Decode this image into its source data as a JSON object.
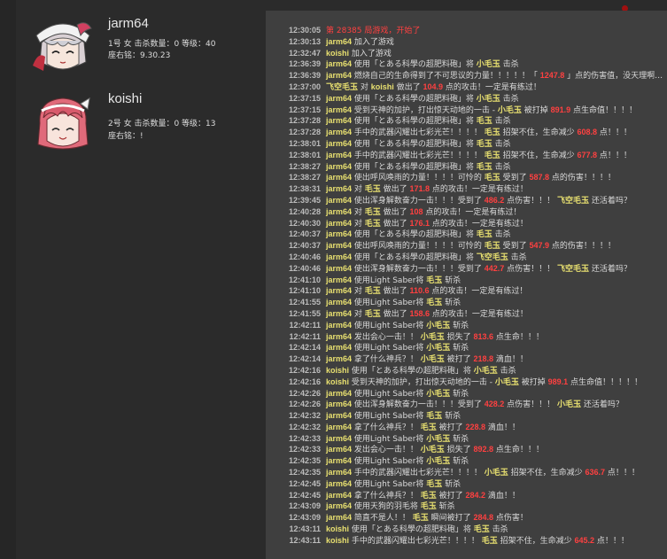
{
  "colors": {
    "background": "#2b2b2b",
    "log_background": "#3f3f3f",
    "timestamp": "#bdbdbd",
    "text": "#dadada",
    "name": "#e8e070",
    "number": "#ff4040"
  },
  "players": [
    {
      "name": "jarm64",
      "stats": "1号 女 击杀数量：0 等级：40",
      "motto": "座右铭：9.30.23",
      "avatar_icon": "silver-hair-girl-avatar"
    },
    {
      "name": "koishi",
      "stats": "2号 女 击杀数量：0 等级：13",
      "motto": "座右铭：!",
      "avatar_icon": "pink-hair-girl-avatar"
    }
  ],
  "log": [
    [
      [
        "12:30:05"
      ],
      [
        "t",
        "第 28385 局游戏，开始了"
      ]
    ],
    [
      [
        "12:30:13"
      ],
      [
        "n",
        "jarm64"
      ],
      [
        "t",
        " 加入了游戏"
      ]
    ],
    [
      [
        "12:32:47"
      ],
      [
        "n",
        "koishi"
      ],
      [
        "t",
        " 加入了游戏"
      ]
    ],
    [
      [
        "12:36:39"
      ],
      [
        "n",
        "jarm64"
      ],
      [
        "t",
        " 使用「とある科學の超肥料砲」将 "
      ],
      [
        "n",
        "小毛玉"
      ],
      [
        "t",
        " 击杀"
      ]
    ],
    [
      [
        "12:36:39"
      ],
      [
        "n",
        "jarm64"
      ],
      [
        "t",
        " 燃烧自己的生命得到了不可思议的力量！！！！！「 "
      ],
      [
        "d",
        "1247.8"
      ],
      [
        "t",
        " 」点的伤害值，没天理啊…"
      ]
    ],
    [
      [
        "12:37:00"
      ],
      [
        "n",
        "飞空毛玉"
      ],
      [
        "t",
        " 对 "
      ],
      [
        "n",
        "koishi"
      ],
      [
        "t",
        " 做出了 "
      ],
      [
        "d",
        "104.9"
      ],
      [
        "t",
        " 点的攻击！一定是有练过！"
      ]
    ],
    [
      [
        "12:37:15"
      ],
      [
        "n",
        "jarm64"
      ],
      [
        "t",
        " 使用「とある科學の超肥料砲」将 "
      ],
      [
        "n",
        "小毛玉"
      ],
      [
        "t",
        " 击杀"
      ]
    ],
    [
      [
        "12:37:15"
      ],
      [
        "n",
        "jarm64"
      ],
      [
        "t",
        " 受到天神的加护，打出惊天动地的一击 - "
      ],
      [
        "n",
        "小毛玉"
      ],
      [
        "t",
        " 被打掉 "
      ],
      [
        "d",
        "891.9"
      ],
      [
        "t",
        " 点生命值！！！！"
      ]
    ],
    [
      [
        "12:37:28"
      ],
      [
        "n",
        "jarm64"
      ],
      [
        "t",
        " 使用「とある科學の超肥料砲」将 "
      ],
      [
        "n",
        "毛玉"
      ],
      [
        "t",
        " 击杀"
      ]
    ],
    [
      [
        "12:37:28"
      ],
      [
        "n",
        "jarm64"
      ],
      [
        "t",
        " 手中的武器闪耀出七彩光芒！！！！ "
      ],
      [
        "n",
        "毛玉"
      ],
      [
        "t",
        " 招架不住，生命减少 "
      ],
      [
        "d",
        "608.8"
      ],
      [
        "t",
        " 点！！！"
      ]
    ],
    [
      [
        "12:38:01"
      ],
      [
        "n",
        "jarm64"
      ],
      [
        "t",
        " 使用「とある科學の超肥料砲」将 "
      ],
      [
        "n",
        "毛玉"
      ],
      [
        "t",
        " 击杀"
      ]
    ],
    [
      [
        "12:38:01"
      ],
      [
        "n",
        "jarm64"
      ],
      [
        "t",
        " 手中的武器闪耀出七彩光芒！！！！ "
      ],
      [
        "n",
        "毛玉"
      ],
      [
        "t",
        " 招架不住，生命减少 "
      ],
      [
        "d",
        "677.8"
      ],
      [
        "t",
        " 点！！！"
      ]
    ],
    [
      [
        "12:38:27"
      ],
      [
        "n",
        "jarm64"
      ],
      [
        "t",
        " 使用「とある科學の超肥料砲」将 "
      ],
      [
        "n",
        "毛玉"
      ],
      [
        "t",
        " 击杀"
      ]
    ],
    [
      [
        "12:38:27"
      ],
      [
        "n",
        "jarm64"
      ],
      [
        "t",
        " 使出呼风唤雨的力量！！！！可怜的 "
      ],
      [
        "n",
        "毛玉"
      ],
      [
        "t",
        " 受到了 "
      ],
      [
        "d",
        "587.8"
      ],
      [
        "t",
        " 点的伤害！！！！"
      ]
    ],
    [
      [
        "12:38:31"
      ],
      [
        "n",
        "jarm64"
      ],
      [
        "t",
        " 对 "
      ],
      [
        "n",
        "毛玉"
      ],
      [
        "t",
        " 做出了 "
      ],
      [
        "d",
        "171.8"
      ],
      [
        "t",
        " 点的攻击！一定是有练过！"
      ]
    ],
    [
      [
        "12:39:45"
      ],
      [
        "n",
        "jarm64"
      ],
      [
        "t",
        " 使出浑身解数奋力一击！！！受到了 "
      ],
      [
        "d",
        "486.2"
      ],
      [
        "t",
        " 点伤害！！！ "
      ],
      [
        "n",
        "飞空毛玉"
      ],
      [
        "t",
        " 还活着吗？"
      ]
    ],
    [
      [
        "12:40:28"
      ],
      [
        "n",
        "jarm64"
      ],
      [
        "t",
        " 对 "
      ],
      [
        "n",
        "毛玉"
      ],
      [
        "t",
        " 做出了 "
      ],
      [
        "d",
        "108"
      ],
      [
        "t",
        " 点的攻击！一定是有练过！"
      ]
    ],
    [
      [
        "12:40:30"
      ],
      [
        "n",
        "jarm64"
      ],
      [
        "t",
        " 对 "
      ],
      [
        "n",
        "毛玉"
      ],
      [
        "t",
        " 做出了 "
      ],
      [
        "d",
        "176.1"
      ],
      [
        "t",
        " 点的攻击！一定是有练过！"
      ]
    ],
    [
      [
        "12:40:37"
      ],
      [
        "n",
        "jarm64"
      ],
      [
        "t",
        " 使用「とある科學の超肥料砲」将 "
      ],
      [
        "n",
        "毛玉"
      ],
      [
        "t",
        " 击杀"
      ]
    ],
    [
      [
        "12:40:37"
      ],
      [
        "n",
        "jarm64"
      ],
      [
        "t",
        " 使出呼风唤雨的力量！！！！可怜的 "
      ],
      [
        "n",
        "毛玉"
      ],
      [
        "t",
        " 受到了 "
      ],
      [
        "d",
        "547.9"
      ],
      [
        "t",
        " 点的伤害！！！！"
      ]
    ],
    [
      [
        "12:40:46"
      ],
      [
        "n",
        "jarm64"
      ],
      [
        "t",
        " 使用「とある科學の超肥料砲」将 "
      ],
      [
        "n",
        "飞空毛玉"
      ],
      [
        "t",
        " 击杀"
      ]
    ],
    [
      [
        "12:40:46"
      ],
      [
        "n",
        "jarm64"
      ],
      [
        "t",
        " 使出浑身解数奋力一击！！！受到了 "
      ],
      [
        "d",
        "442.7"
      ],
      [
        "t",
        " 点伤害！！！ "
      ],
      [
        "n",
        "飞空毛玉"
      ],
      [
        "t",
        " 还活着吗？"
      ]
    ],
    [
      [
        "12:41:10"
      ],
      [
        "n",
        "jarm64"
      ],
      [
        "t",
        " 使用Light Saber将 "
      ],
      [
        "n",
        "毛玉"
      ],
      [
        "t",
        " 斩杀"
      ]
    ],
    [
      [
        "12:41:10"
      ],
      [
        "n",
        "jarm64"
      ],
      [
        "t",
        " 对 "
      ],
      [
        "n",
        "毛玉"
      ],
      [
        "t",
        " 做出了 "
      ],
      [
        "d",
        "110.6"
      ],
      [
        "t",
        " 点的攻击！一定是有练过！"
      ]
    ],
    [
      [
        "12:41:55"
      ],
      [
        "n",
        "jarm64"
      ],
      [
        "t",
        " 使用Light Saber将 "
      ],
      [
        "n",
        "毛玉"
      ],
      [
        "t",
        " 斩杀"
      ]
    ],
    [
      [
        "12:41:55"
      ],
      [
        "n",
        "jarm64"
      ],
      [
        "t",
        " 对 "
      ],
      [
        "n",
        "毛玉"
      ],
      [
        "t",
        " 做出了 "
      ],
      [
        "d",
        "158.6"
      ],
      [
        "t",
        " 点的攻击！一定是有练过！"
      ]
    ],
    [
      [
        "12:42:11"
      ],
      [
        "n",
        "jarm64"
      ],
      [
        "t",
        " 使用Light Saber将 "
      ],
      [
        "n",
        "小毛玉"
      ],
      [
        "t",
        " 斩杀"
      ]
    ],
    [
      [
        "12:42:11"
      ],
      [
        "n",
        "jarm64"
      ],
      [
        "t",
        " 发出会心一击！！ "
      ],
      [
        "n",
        "小毛玉"
      ],
      [
        "t",
        " 损失了 "
      ],
      [
        "d",
        "813.6"
      ],
      [
        "t",
        " 点生命！！！"
      ]
    ],
    [
      [
        "12:42:14"
      ],
      [
        "n",
        "jarm64"
      ],
      [
        "t",
        " 使用Light Saber将 "
      ],
      [
        "n",
        "小毛玉"
      ],
      [
        "t",
        " 斩杀"
      ]
    ],
    [
      [
        "12:42:14"
      ],
      [
        "n",
        "jarm64"
      ],
      [
        "t",
        " 拿了什么神兵？！ "
      ],
      [
        "n",
        "小毛玉"
      ],
      [
        "t",
        " 被打了 "
      ],
      [
        "d",
        "218.8"
      ],
      [
        "t",
        " 滴血！！"
      ]
    ],
    [
      [
        "12:42:16"
      ],
      [
        "n",
        "koishi"
      ],
      [
        "t",
        " 使用「とある科學の超肥料砲」将 "
      ],
      [
        "n",
        "小毛玉"
      ],
      [
        "t",
        " 击杀"
      ]
    ],
    [
      [
        "12:42:16"
      ],
      [
        "n",
        "koishi"
      ],
      [
        "t",
        " 受到天神的加护，打出惊天动地的一击 - "
      ],
      [
        "n",
        "小毛玉"
      ],
      [
        "t",
        " 被打掉 "
      ],
      [
        "d",
        "989.1"
      ],
      [
        "t",
        " 点生命值！！！！！"
      ]
    ],
    [
      [
        "12:42:26"
      ],
      [
        "n",
        "jarm64"
      ],
      [
        "t",
        " 使用Light Saber将 "
      ],
      [
        "n",
        "小毛玉"
      ],
      [
        "t",
        " 斩杀"
      ]
    ],
    [
      [
        "12:42:26"
      ],
      [
        "n",
        "jarm64"
      ],
      [
        "t",
        " 使出浑身解数奋力一击！！！受到了 "
      ],
      [
        "d",
        "428.2"
      ],
      [
        "t",
        " 点伤害！！！ "
      ],
      [
        "n",
        "小毛玉"
      ],
      [
        "t",
        " 还活着吗？"
      ]
    ],
    [
      [
        "12:42:32"
      ],
      [
        "n",
        "jarm64"
      ],
      [
        "t",
        " 使用Light Saber将 "
      ],
      [
        "n",
        "毛玉"
      ],
      [
        "t",
        " 斩杀"
      ]
    ],
    [
      [
        "12:42:32"
      ],
      [
        "n",
        "jarm64"
      ],
      [
        "t",
        " 拿了什么神兵？！ "
      ],
      [
        "n",
        "毛玉"
      ],
      [
        "t",
        " 被打了 "
      ],
      [
        "d",
        "228.8"
      ],
      [
        "t",
        " 滴血！！"
      ]
    ],
    [
      [
        "12:42:33"
      ],
      [
        "n",
        "jarm64"
      ],
      [
        "t",
        " 使用Light Saber将 "
      ],
      [
        "n",
        "小毛玉"
      ],
      [
        "t",
        " 斩杀"
      ]
    ],
    [
      [
        "12:42:33"
      ],
      [
        "n",
        "jarm64"
      ],
      [
        "t",
        " 发出会心一击！！ "
      ],
      [
        "n",
        "小毛玉"
      ],
      [
        "t",
        " 损失了 "
      ],
      [
        "d",
        "892.8"
      ],
      [
        "t",
        " 点生命！！！"
      ]
    ],
    [
      [
        "12:42:35"
      ],
      [
        "n",
        "jarm64"
      ],
      [
        "t",
        " 使用Light Saber将 "
      ],
      [
        "n",
        "小毛玉"
      ],
      [
        "t",
        " 斩杀"
      ]
    ],
    [
      [
        "12:42:35"
      ],
      [
        "n",
        "jarm64"
      ],
      [
        "t",
        " 手中的武器闪耀出七彩光芒！！！！ "
      ],
      [
        "n",
        "小毛玉"
      ],
      [
        "t",
        " 招架不住，生命减少 "
      ],
      [
        "d",
        "636.7"
      ],
      [
        "t",
        " 点！！！"
      ]
    ],
    [
      [
        "12:42:45"
      ],
      [
        "n",
        "jarm64"
      ],
      [
        "t",
        " 使用Light Saber将 "
      ],
      [
        "n",
        "毛玉"
      ],
      [
        "t",
        " 斩杀"
      ]
    ],
    [
      [
        "12:42:45"
      ],
      [
        "n",
        "jarm64"
      ],
      [
        "t",
        " 拿了什么神兵？！ "
      ],
      [
        "n",
        "毛玉"
      ],
      [
        "t",
        " 被打了 "
      ],
      [
        "d",
        "284.2"
      ],
      [
        "t",
        " 滴血！！"
      ]
    ],
    [
      [
        "12:43:09"
      ],
      [
        "n",
        "jarm64"
      ],
      [
        "t",
        " 使用天狗的羽毛将 "
      ],
      [
        "n",
        "毛玉"
      ],
      [
        "t",
        " 斩杀"
      ]
    ],
    [
      [
        "12:43:09"
      ],
      [
        "n",
        "jarm64"
      ],
      [
        "t",
        " 简直不是人！！ "
      ],
      [
        "n",
        "毛玉"
      ],
      [
        "t",
        " 瞬间被打了 "
      ],
      [
        "d",
        "284.8"
      ],
      [
        "t",
        " 点伤害！"
      ]
    ],
    [
      [
        "12:43:11"
      ],
      [
        "n",
        "koishi"
      ],
      [
        "t",
        " 使用「とある科學の超肥料砲」将 "
      ],
      [
        "n",
        "毛玉"
      ],
      [
        "t",
        " 击杀"
      ]
    ],
    [
      [
        "12:43:11"
      ],
      [
        "n",
        "koishi"
      ],
      [
        "t",
        " 手中的武器闪耀出七彩光芒！！！！ "
      ],
      [
        "n",
        "毛玉"
      ],
      [
        "t",
        " 招架不住，生命减少 "
      ],
      [
        "d",
        "645.2"
      ],
      [
        "t",
        " 点！！！"
      ]
    ]
  ]
}
